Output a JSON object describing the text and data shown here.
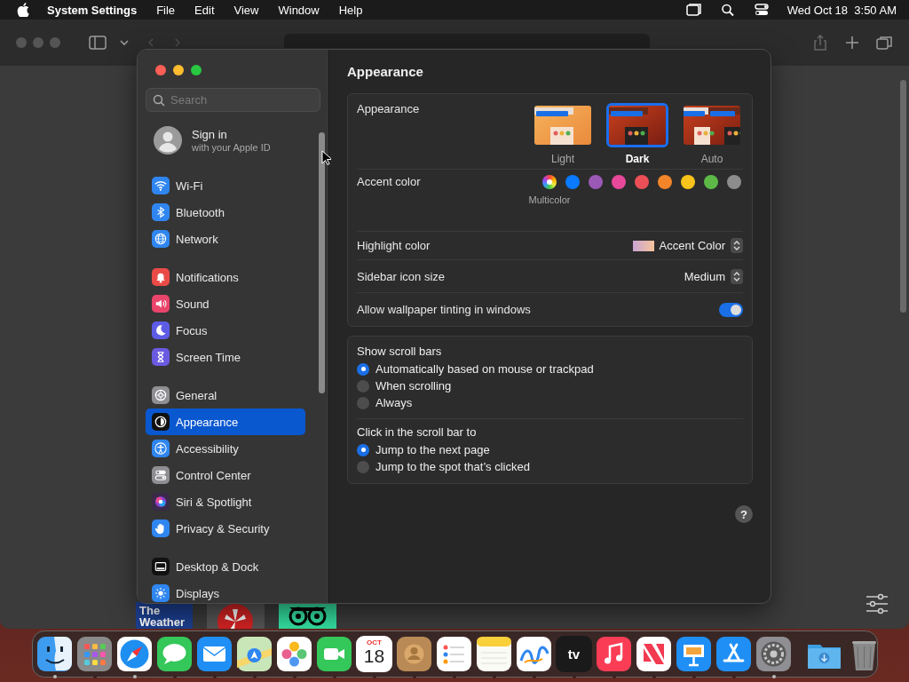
{
  "menu_bar": {
    "app_name": "System Settings",
    "menus": [
      "File",
      "Edit",
      "View",
      "Window",
      "Help"
    ],
    "clock": "Wed Oct 18  3:50 AM"
  },
  "browser": {
    "tiles": [
      {
        "kind": "weather",
        "text": "The Weather"
      },
      {
        "kind": "flower"
      },
      {
        "kind": "owl"
      }
    ]
  },
  "settings": {
    "search_placeholder": "Search",
    "account": {
      "title": "Sign in",
      "subtitle": "with your Apple ID"
    },
    "sidebar_groups": [
      [
        {
          "label": "Wi-Fi",
          "kind": "wifi",
          "color": "#2f86f0",
          "selected": false
        },
        {
          "label": "Bluetooth",
          "kind": "bluetooth",
          "color": "#2f86f0",
          "selected": false
        },
        {
          "label": "Network",
          "kind": "globe",
          "color": "#2f86f0",
          "selected": false
        }
      ],
      [
        {
          "label": "Notifications",
          "kind": "bell",
          "color": "#ea4b47",
          "selected": false
        },
        {
          "label": "Sound",
          "kind": "speaker",
          "color": "#e9446a",
          "selected": false
        },
        {
          "label": "Focus",
          "kind": "moon",
          "color": "#5e5ce6",
          "selected": false
        },
        {
          "label": "Screen Time",
          "kind": "hourglass",
          "color": "#6a5ae0",
          "selected": false
        }
      ],
      [
        {
          "label": "General",
          "kind": "gear",
          "color": "#8e8e93",
          "selected": false
        },
        {
          "label": "Appearance",
          "kind": "contrast",
          "color": "#111111",
          "selected": true
        },
        {
          "label": "Accessibility",
          "kind": "person",
          "color": "#2f86f0",
          "selected": false
        },
        {
          "label": "Control Center",
          "kind": "toggles",
          "color": "#8e8e93",
          "selected": false
        },
        {
          "label": "Siri & Spotlight",
          "kind": "orb",
          "color": "#3a2a4a",
          "selected": false
        },
        {
          "label": "Privacy & Security",
          "kind": "hand",
          "color": "#2f86f0",
          "selected": false
        }
      ],
      [
        {
          "label": "Desktop & Dock",
          "kind": "dock",
          "color": "#111111",
          "selected": false
        },
        {
          "label": "Displays",
          "kind": "sun",
          "color": "#2f86f0",
          "selected": false
        }
      ]
    ],
    "title": "Appearance",
    "appearance": {
      "label": "Appearance",
      "options": [
        {
          "label": "Light",
          "kind": "light",
          "selected": false
        },
        {
          "label": "Dark",
          "kind": "dark",
          "selected": true
        },
        {
          "label": "Auto",
          "kind": "auto",
          "selected": false
        }
      ]
    },
    "accent": {
      "label": "Accent color",
      "swatches": [
        {
          "kind": "multicolor",
          "label": "Multicolor",
          "selected": true
        },
        {
          "kind": "solid",
          "color": "#0a7aff",
          "selected": false
        },
        {
          "kind": "solid",
          "color": "#9b59b6",
          "selected": false
        },
        {
          "kind": "solid",
          "color": "#e8489a",
          "selected": false
        },
        {
          "kind": "solid",
          "color": "#ec4f55",
          "selected": false
        },
        {
          "kind": "solid",
          "color": "#f2842a",
          "selected": false
        },
        {
          "kind": "solid",
          "color": "#f8c31a",
          "selected": false
        },
        {
          "kind": "solid",
          "color": "#5cb947",
          "selected": false
        },
        {
          "kind": "solid",
          "color": "#8c8c8c",
          "selected": false
        }
      ]
    },
    "highlight": {
      "label": "Highlight color",
      "value": "Accent Color"
    },
    "icon_size": {
      "label": "Sidebar icon size",
      "value": "Medium"
    },
    "tinting": {
      "label": "Allow wallpaper tinting in windows",
      "on": true
    },
    "scroll_bars": {
      "label": "Show scroll bars",
      "options": [
        {
          "label": "Automatically based on mouse or trackpad",
          "selected": true
        },
        {
          "label": "When scrolling",
          "selected": false
        },
        {
          "label": "Always",
          "selected": false
        }
      ]
    },
    "click_action": {
      "label": "Click in the scroll bar to",
      "options": [
        {
          "label": "Jump to the next page",
          "selected": true
        },
        {
          "label": "Jump to the spot that’s clicked",
          "selected": false
        }
      ]
    },
    "help_button": "?"
  },
  "dock": {
    "apps": [
      {
        "kind": "finder",
        "running": true
      },
      {
        "kind": "launchpad",
        "running": false
      },
      {
        "kind": "safari",
        "running": true
      },
      {
        "kind": "messages",
        "running": false
      },
      {
        "kind": "mail",
        "running": false
      },
      {
        "kind": "maps",
        "running": false
      },
      {
        "kind": "photos",
        "running": false
      },
      {
        "kind": "facetime",
        "running": false
      },
      {
        "kind": "calendar",
        "month": "OCT",
        "day": "18",
        "running": false
      },
      {
        "kind": "contacts",
        "running": false
      },
      {
        "kind": "reminders",
        "running": false
      },
      {
        "kind": "notes",
        "running": false
      },
      {
        "kind": "freeform",
        "running": false
      },
      {
        "kind": "tv",
        "text": "tv",
        "running": false
      },
      {
        "kind": "music",
        "running": false
      },
      {
        "kind": "news",
        "running": false
      },
      {
        "kind": "keynote",
        "running": false
      },
      {
        "kind": "appstore",
        "running": false
      },
      {
        "kind": "settings",
        "running": true
      }
    ],
    "stacks": [
      {
        "kind": "downloads"
      },
      {
        "kind": "trash"
      }
    ]
  }
}
